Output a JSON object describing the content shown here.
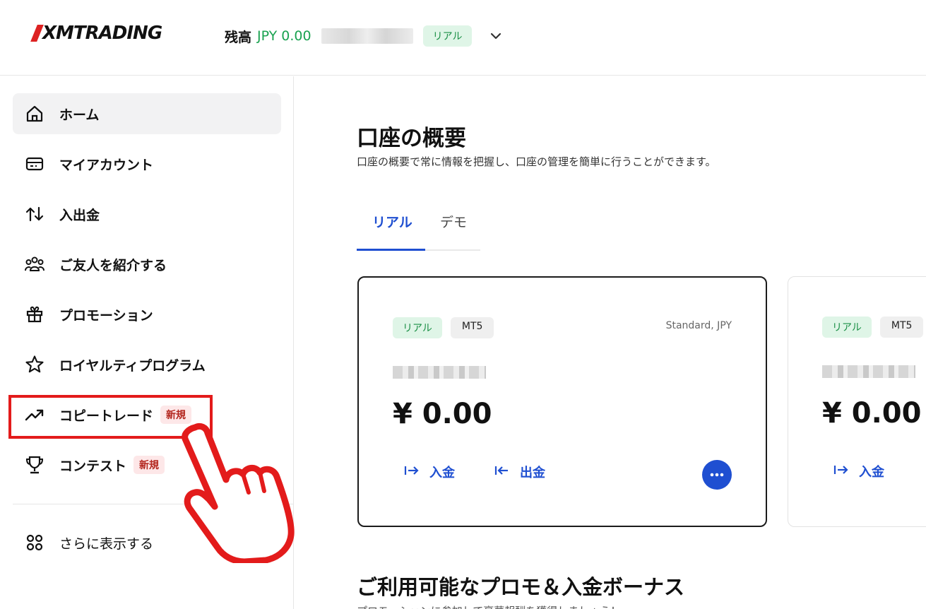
{
  "header": {
    "logo": "XMTRADING",
    "balance_label": "残高",
    "balance_value": "JPY 0.00",
    "account_badge": "リアル"
  },
  "sidebar": {
    "items": [
      {
        "label": "ホーム",
        "icon": "home-icon"
      },
      {
        "label": "マイアカウント",
        "icon": "card-icon"
      },
      {
        "label": "入出金",
        "icon": "transfer-icon"
      },
      {
        "label": "ご友人を紹介する",
        "icon": "people-icon"
      },
      {
        "label": "プロモーション",
        "icon": "gift-icon"
      },
      {
        "label": "ロイヤルティプログラム",
        "icon": "star-icon"
      },
      {
        "label": "コピートレード",
        "icon": "trend-icon",
        "tag": "新規"
      },
      {
        "label": "コンテスト",
        "icon": "trophy-icon",
        "tag": "新規"
      }
    ],
    "more_label": "さらに表示する"
  },
  "main": {
    "title": "口座の概要",
    "subtitle": "口座の概要で常に情報を把握し、口座の管理を簡単に行うことができます。",
    "tabs": [
      {
        "label": "リアル"
      },
      {
        "label": "デモ"
      }
    ],
    "cards": [
      {
        "tag1": "リアル",
        "tag2": "MT5",
        "type": "Standard, JPY",
        "amount": "¥ 0.00",
        "deposit": "入金",
        "withdraw": "出金"
      },
      {
        "tag1": "リアル",
        "tag2": "MT5",
        "amount": "¥ 0.00",
        "deposit": "入金"
      }
    ],
    "promo_title": "ご利用可能なプロモ＆入金ボーナス",
    "promo_sub": "プロモーションに参加して豪華報酬を獲得しましょう！"
  },
  "colors": {
    "accent": "#1f4fd1",
    "positive": "#1aa250",
    "highlight": "#e31b1b"
  }
}
